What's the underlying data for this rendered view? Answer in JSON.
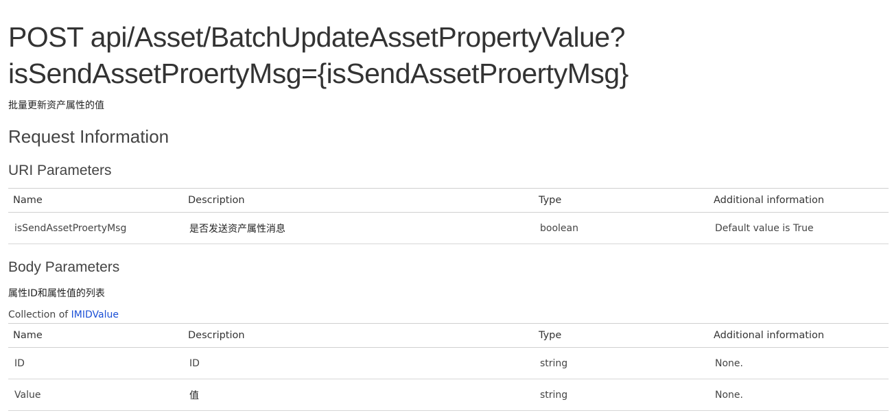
{
  "title": "POST api/Asset/BatchUpdateAssetPropertyValue?isSendAssetProertyMsg={isSendAssetProertyMsg}",
  "description": "批量更新资产属性的值",
  "request_heading": "Request Information",
  "uri_params": {
    "heading": "URI Parameters",
    "columns": [
      "Name",
      "Description",
      "Type",
      "Additional information"
    ],
    "rows": [
      {
        "name": "isSendAssetProertyMsg",
        "description": "是否发送资产属性消息",
        "type": "boolean",
        "additional": "Default value is True"
      }
    ]
  },
  "body_params": {
    "heading": "Body Parameters",
    "description": "属性ID和属性值的列表",
    "collection_prefix": "Collection of",
    "collection_link": "IMIDValue",
    "columns": [
      "Name",
      "Description",
      "Type",
      "Additional information"
    ],
    "rows": [
      {
        "name": "ID",
        "description": "ID",
        "type": "string",
        "additional": "None."
      },
      {
        "name": "Value",
        "description": "值",
        "type": "string",
        "additional": "None."
      }
    ]
  },
  "colors": {
    "link": "#1a4fd6",
    "border": "#cfcfcf"
  }
}
